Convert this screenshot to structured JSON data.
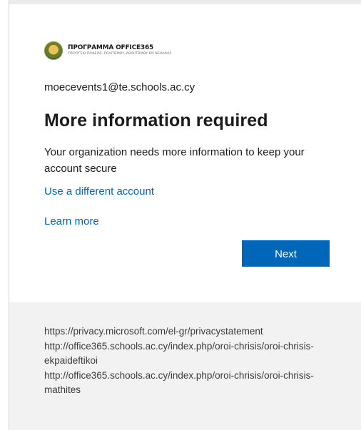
{
  "logo": {
    "title": "ΠΡΟΓΡΑΜΜΑ OFFICE365",
    "subtitle": "ΥΠΟΥΡΓΕΙΟ ΠΑΙΔΕΙΑΣ, ΠΟΛΙΤΙΣΜΟΥ, ΑΘΛΗΤΙΣΜΟΥ ΚΑΙ ΝΕΟΛΑΙΑΣ",
    "icon": "coat-of-arms-emblem"
  },
  "account": {
    "email": "moecevents1@te.schools.ac.cy"
  },
  "main": {
    "heading": "More information required",
    "description": "Your organization needs more information to keep your account secure",
    "use_different_account": "Use a different account",
    "learn_more": "Learn more",
    "next_label": "Next"
  },
  "footer": {
    "links": [
      "https://privacy.microsoft.com/el-gr/privacystatement",
      "http://office365.schools.ac.cy/index.php/oroi-chrisis/oroi-chrisis-ekpaideftikoi",
      "http://office365.schools.ac.cy/index.php/oroi-chrisis/oroi-chrisis-mathites"
    ]
  },
  "colors": {
    "accent": "#0067b8",
    "text": "#1b1b1b",
    "footer_bg": "#f2f2f2"
  }
}
